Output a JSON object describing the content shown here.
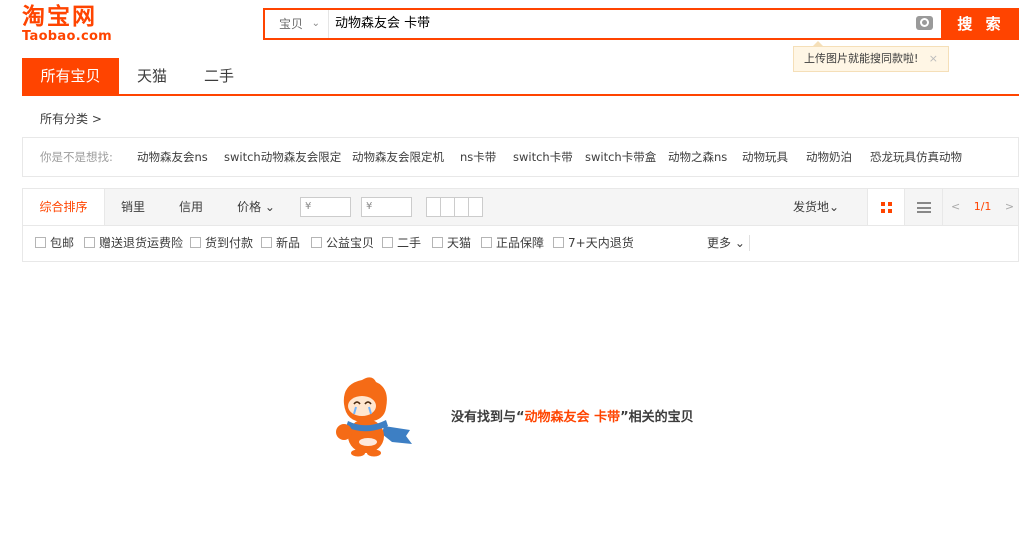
{
  "logo": {
    "cn": "淘宝网",
    "en": "Taobao.com"
  },
  "search": {
    "category": "宝贝",
    "query": "动物森友会 卡带",
    "button_label": "搜 索",
    "tooltip": "上传图片就能搜同款啦!",
    "tooltip_close": "×"
  },
  "tabs": [
    "所有宝贝",
    "天猫",
    "二手"
  ],
  "category_path": "所有分类 >",
  "suggestions": {
    "label": "你是不是想找:",
    "items": [
      "动物森友会ns",
      "switch动物森友会限定",
      "动物森友会限定机",
      "ns卡带",
      "switch卡带",
      "switch卡带盒",
      "动物之森ns",
      "动物玩具",
      "动物奶泊",
      "恐龙玩具仿真动物"
    ]
  },
  "sort": {
    "items": [
      "综合排序",
      "销里",
      "信用",
      "价格 ⌄"
    ],
    "price_min_placeholder": "¥",
    "price_max_placeholder": "¥",
    "dash": "-",
    "ship_from": "发货地⌄",
    "pager": "1/1",
    "prev": "<",
    "next": ">"
  },
  "filters": [
    "包邮",
    "赠送退货运费险",
    "货到付款",
    "新品",
    "公益宝贝",
    "二手",
    "天猫",
    "正品保障",
    "7+天内退货"
  ],
  "more_label": "更多 ⌄",
  "empty": {
    "prefix": "没有找到与“",
    "keyword": "动物森友会 卡带",
    "suffix": "”相关的宝贝"
  },
  "colors": {
    "brand": "#ff4400"
  }
}
